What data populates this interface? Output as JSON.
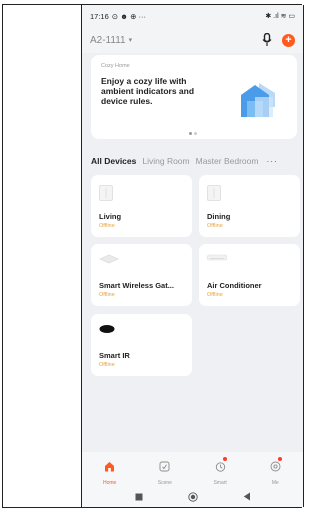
{
  "status_bar": {
    "time": "17:16",
    "left_icons": "⊙ ☻ ⊕ ···",
    "right_icons": "✱ .ıl ≋ ▭"
  },
  "header": {
    "home_name": "A2-1111",
    "dropdown_glyph": "▾"
  },
  "banner": {
    "tag": "Cozy Home",
    "title": "Enjoy a cozy life with ambient indicators and device rules.",
    "page_count": 2,
    "active_page": 1
  },
  "tabs": [
    {
      "label": "All Devices",
      "active": true
    },
    {
      "label": "Living Room",
      "active": false
    },
    {
      "label": "Master Bedroom",
      "active": false
    }
  ],
  "tabs_more": "···",
  "devices": [
    {
      "name": "Living",
      "status": "Offline",
      "icon": "panel-switch-icon"
    },
    {
      "name": "Dining",
      "status": "Offline",
      "icon": "panel-switch-icon"
    },
    {
      "name": "Smart Wireless Gat...",
      "status": "Offline",
      "icon": "gateway-icon"
    },
    {
      "name": "Air Conditioner",
      "status": "Offline",
      "icon": "air-conditioner-icon"
    },
    {
      "name": "Smart IR",
      "status": "Offline",
      "icon": "ir-remote-icon"
    }
  ],
  "tab_bar": [
    {
      "label": "Home",
      "icon": "home-icon",
      "active": true,
      "badge": false
    },
    {
      "label": "Scene",
      "icon": "scene-icon",
      "active": false,
      "badge": false
    },
    {
      "label": "Smart",
      "icon": "smart-icon",
      "active": false,
      "badge": true
    },
    {
      "label": "Me",
      "icon": "me-icon",
      "active": false,
      "badge": true
    }
  ],
  "colors": {
    "accent": "#ff5a1f",
    "offline": "#e9a23b",
    "background": "#eef0f3"
  }
}
